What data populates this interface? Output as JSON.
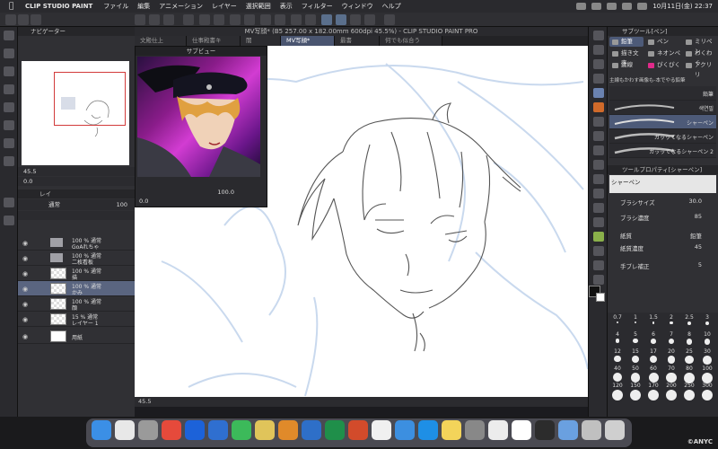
{
  "menubar": {
    "apple": "",
    "app_name": "CLIP STUDIO PAINT",
    "items": [
      "ファイル",
      "編集",
      "アニメーション",
      "レイヤー",
      "選択範囲",
      "表示",
      "フィルター",
      "ウィンドウ",
      "ヘルプ"
    ],
    "datetime": "10月11日(金) 22:37"
  },
  "window_title": "MV写顔* (B5 257.00 x 182.00mm 600dpi 45.5%) - CLIP STUDIO PAINT PRO",
  "tabs": [
    "文殿仕上",
    "仕事殿書キ",
    "闇",
    "MV写顔*",
    "最書",
    "何でも似合う"
  ],
  "active_tab_index": 3,
  "navigator": {
    "header": "ナビゲーター",
    "zoom": "45.5",
    "rotate": "0.0"
  },
  "layers_panel": {
    "header": "レイ",
    "blend_mode": "通常",
    "opacity": "100",
    "layers": [
      {
        "line1": "100 % 通常",
        "line2": "GoAれちゃ",
        "type": "folder",
        "selected": false
      },
      {
        "line1": "100 % 通常",
        "line2": "二枚看板",
        "type": "folder",
        "selected": false
      },
      {
        "line1": "100 % 通常",
        "line2": "描",
        "type": "raster",
        "selected": false
      },
      {
        "line1": "100 % 通常",
        "line2": "かみ",
        "type": "raster",
        "selected": true
      },
      {
        "line1": "100 % 通常",
        "line2": "顔",
        "type": "raster",
        "selected": false
      },
      {
        "line1": "15 % 通常",
        "line2": "レイヤー 1",
        "type": "raster",
        "selected": false
      },
      {
        "line1": "",
        "line2": "用紙",
        "type": "paper",
        "selected": false
      }
    ]
  },
  "subview": {
    "header": "サブビュー",
    "zoom": "100.0",
    "rotate": "0.0"
  },
  "status": {
    "zoom": "45.5"
  },
  "right_panel": {
    "subtool_header": "サブツール[ペン]",
    "subtools": [
      {
        "label": "鉛筆",
        "on": true
      },
      {
        "label": "ペン",
        "on": false
      },
      {
        "label": "ミリペン",
        "on": false
      },
      {
        "label": "描き文字",
        "on": false
      },
      {
        "label": "ネオンペ",
        "on": false
      },
      {
        "label": "わくわく",
        "on": false
      },
      {
        "label": "鍵線",
        "on": false
      },
      {
        "label": "ぴくぴく",
        "on": false
      },
      {
        "label": "アクリリ",
        "on": false
      }
    ],
    "group_label": "主線もかわす画像も-本でやる鉛筆",
    "brushes": [
      "鉛筆",
      "색연필",
      "シャーペン",
      "ガッッてなるシャーペン",
      "ガッッてなるシャーペン 2"
    ],
    "selected_brush_index": 2,
    "props_header": "ツールプロパティ[シャーペン]",
    "props_brush_name": "シャーペン",
    "props": [
      {
        "label": "ブラシサイズ",
        "value": "30.0"
      },
      {
        "label": "ブラシ濃度",
        "value": "85"
      },
      {
        "label": "紙質",
        "value": "鉛筆"
      },
      {
        "label": "紙質濃度",
        "value": "45"
      },
      {
        "label": "手ブレ補正",
        "value": "5"
      }
    ]
  },
  "brush_sizes": [
    "0.7",
    "1",
    "1.5",
    "2",
    "2.5",
    "3",
    "4",
    "5",
    "6",
    "7",
    "8",
    "10",
    "12",
    "15",
    "17",
    "20",
    "25",
    "30",
    "40",
    "50",
    "60",
    "70",
    "80",
    "100",
    "120",
    "150",
    "170",
    "200",
    "250",
    "300"
  ],
  "dock": {
    "colors": [
      "#3b8fe6",
      "#e8e8e8",
      "#9a9a9a",
      "#e64a3b",
      "#1c62d9",
      "#2f6fd0",
      "#3cba5a",
      "#e0c45a",
      "#e08a2a",
      "#2e6fc8",
      "#1f8f4a",
      "#d24b2b",
      "#f0f0f0",
      "#3c8fe0",
      "#1e8fe6",
      "#f3d45a",
      "#888888",
      "#ececec",
      "#ffffff",
      "#2c2c2c",
      "#6aa0e0",
      "#c0c0c0",
      "#cfcfcf"
    ]
  },
  "watermark": "©ANYC"
}
